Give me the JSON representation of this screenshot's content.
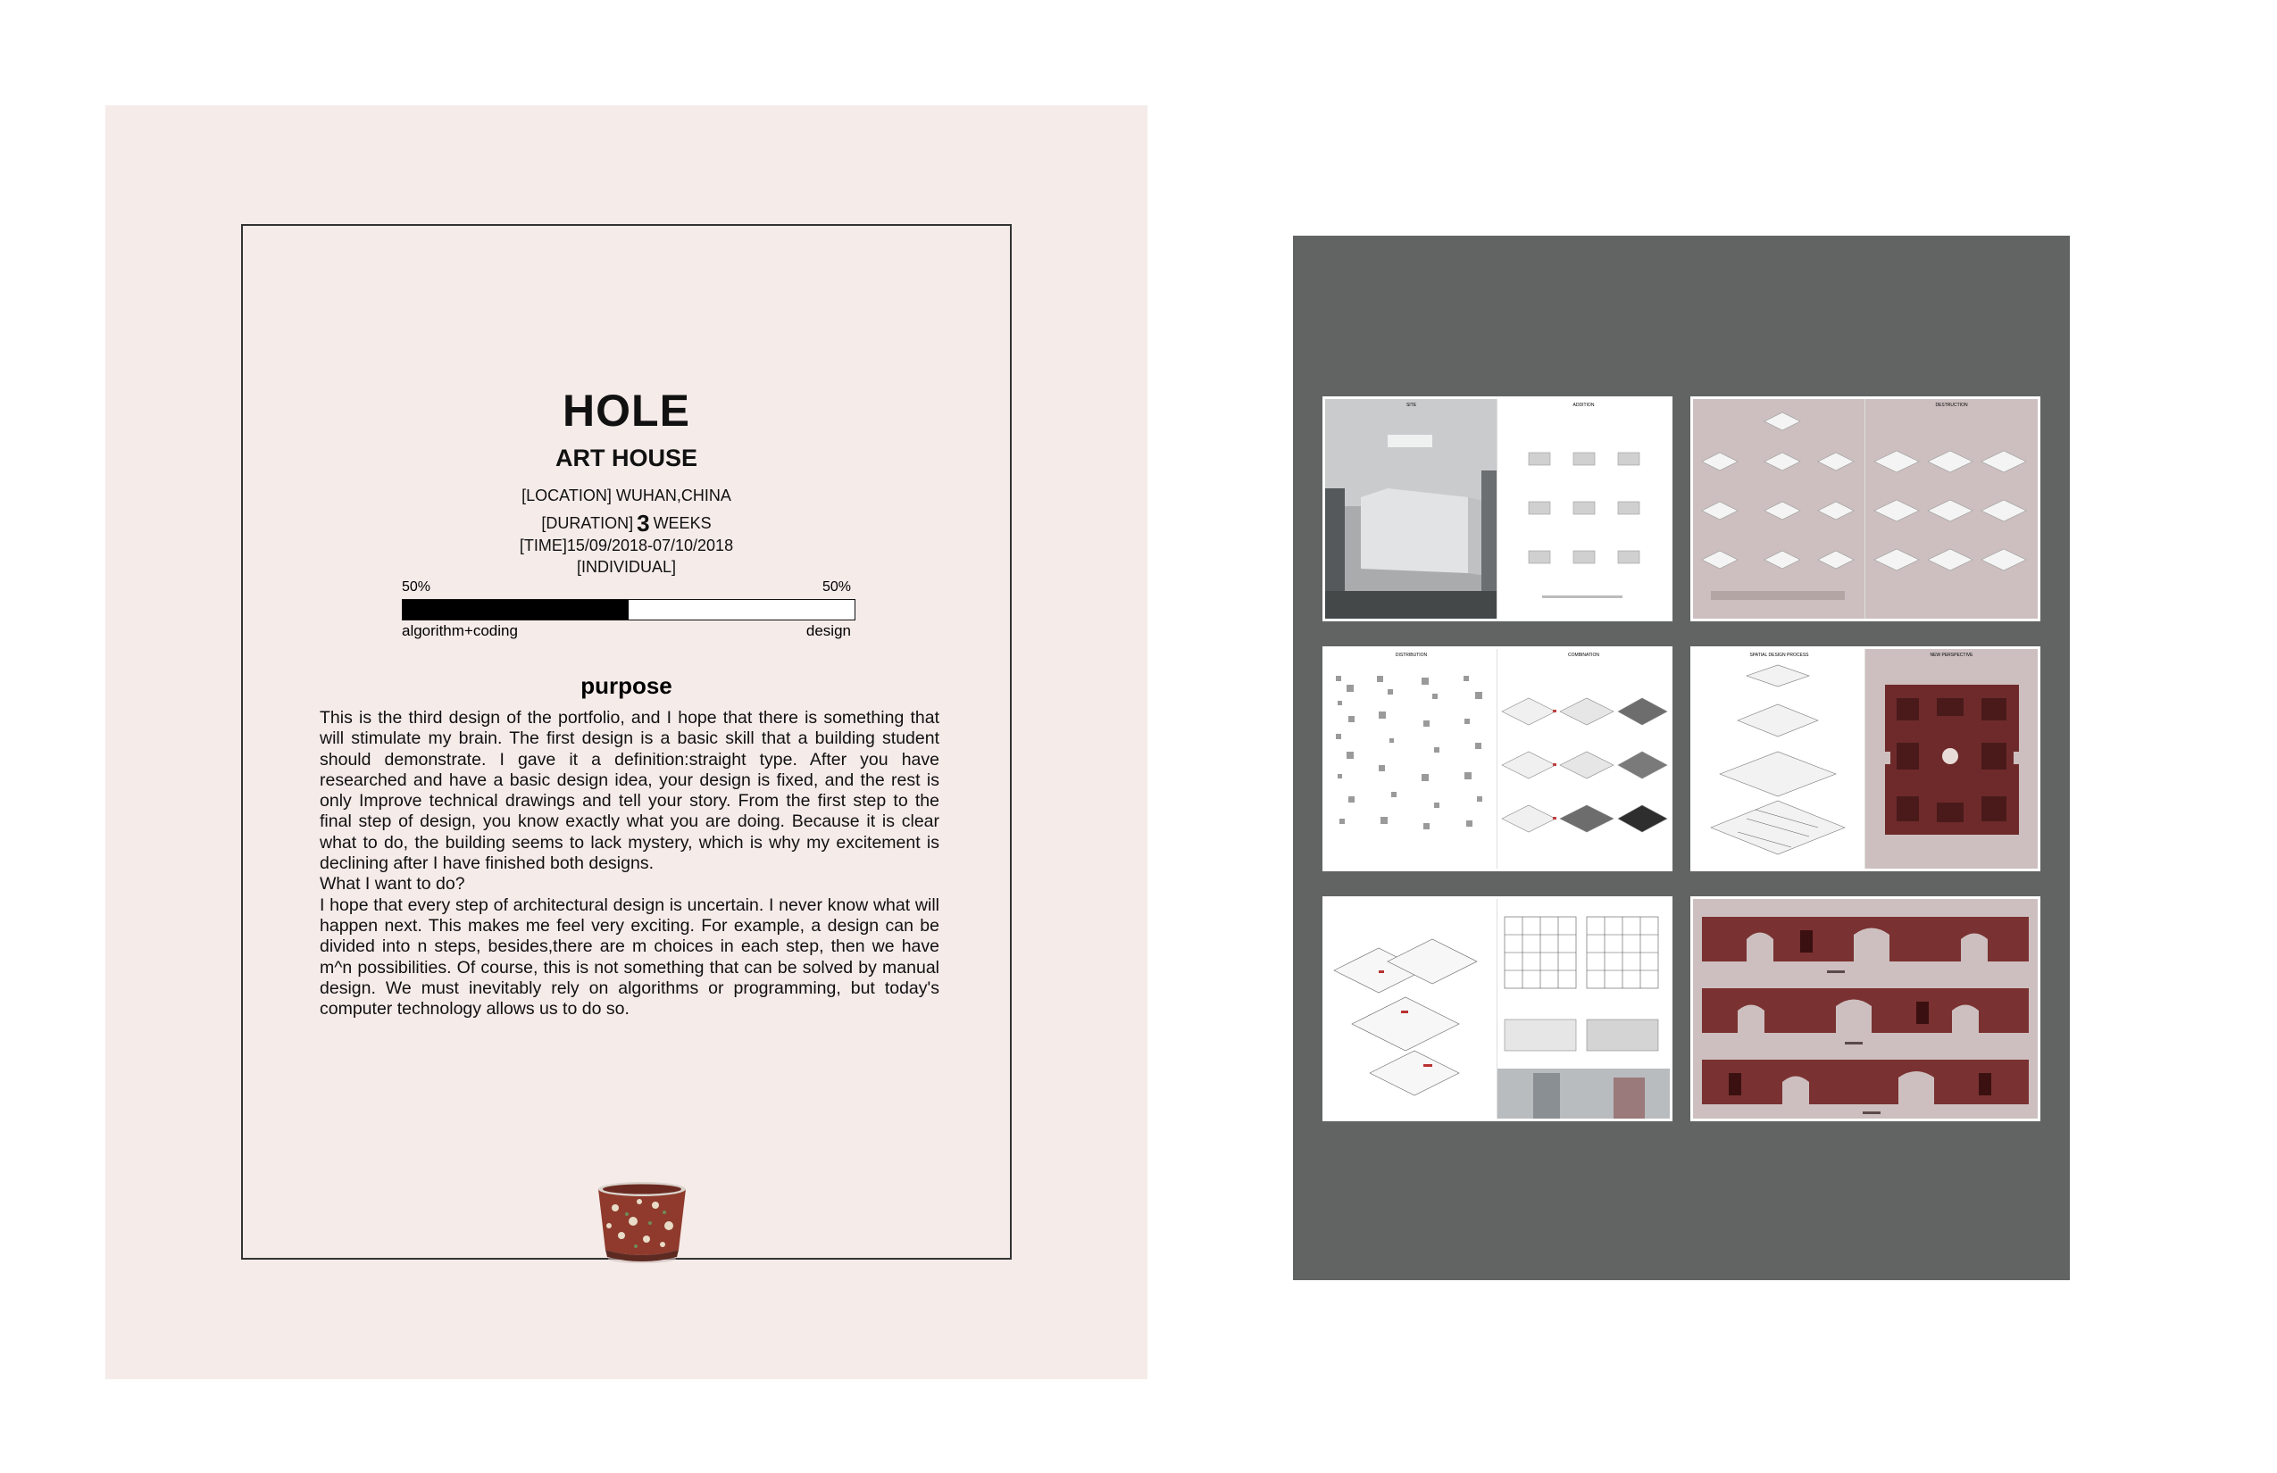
{
  "project": {
    "title": "HOLE",
    "subtitle": "ART HOUSE",
    "location": "[LOCATION] WUHAN,CHINA",
    "duration_prefix": "[DURATION]",
    "duration_value": "3",
    "duration_suffix": "WEEKS",
    "time": "[TIME]15/09/2018-07/10/2018",
    "type": "[INDIVIDUAL]"
  },
  "ratio": {
    "left_percent_label": "50%",
    "right_percent_label": "50%",
    "left_label": "algorithm+coding",
    "right_label": "design",
    "fraction": 0.5
  },
  "purpose": {
    "heading": "purpose",
    "paragraph1": "This is the third design of the portfolio, and I hope that there is something that will stimulate my brain. The first design is a basic skill that a building student should demonstrate. I gave it a definition:straight type. After you have researched and have a basic design idea, your design is fixed, and the rest is only Improve technical drawings and tell your story. From the first step to the final step of design, you know exactly what you are doing. Because it is clear what to do, the building seems to lack mystery, which is why my excitement is declining after I have finished both designs.",
    "question": "What I want to do?",
    "paragraph2": "I hope that every step of architectural design  is uncertain. I never know what will happen next. This makes me feel very exciting. For example, a design can be divided into n steps, besides,there are m choices in each step, then we have m^n possibilities. Of course, this is not something that can be solved by manual design. We must inevitably rely on algorithms or programming, but today's computer technology allows us to do so."
  },
  "colors": {
    "left_page_bg": "#f5ebe9",
    "right_panel_bg": "#626463",
    "accent_red": "#7a3131",
    "pink_page": "#cdbfbf"
  },
  "thumbnails": {
    "spread1": {
      "left_title": "SITE",
      "right_title": "ADDITION"
    },
    "spread2": {
      "left_title": "",
      "right_title": "DESTRUCTION"
    },
    "spread3": {
      "left_title": "DISTRIBUTION",
      "right_title": "COMBINATION"
    },
    "spread4": {
      "left_title": "SPATIAL DESIGN PROCESS",
      "right_title": "NEW PERSPECTIVE"
    },
    "spread5": {
      "left_title": "",
      "right_title": ""
    },
    "spread6": {
      "left_title": "",
      "right_title": ""
    }
  }
}
